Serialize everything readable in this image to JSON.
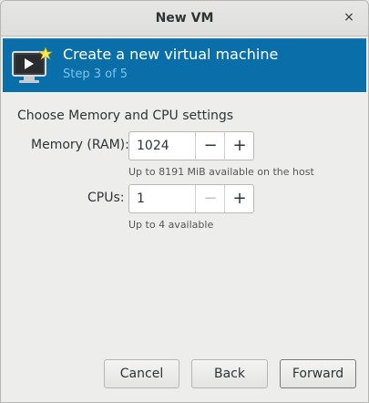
{
  "window": {
    "title": "New VM"
  },
  "header": {
    "title": "Create a new virtual machine",
    "step": "Step 3 of 5"
  },
  "section": {
    "heading": "Choose Memory and CPU settings"
  },
  "memory": {
    "label": "Memory (RAM):",
    "value": "1024",
    "hint": "Up to 8191 MiB available on the host",
    "decrement": "−",
    "increment": "+"
  },
  "cpus": {
    "label": "CPUs:",
    "value": "1",
    "hint": "Up to 4 available",
    "decrement": "−",
    "increment": "+"
  },
  "buttons": {
    "cancel": "Cancel",
    "back": "Back",
    "forward": "Forward"
  },
  "icons": {
    "close": "×",
    "header": "virtual-machine-screen-icon"
  },
  "colors": {
    "header_bg": "#0a6ea8",
    "header_step": "#7fc2ec"
  }
}
